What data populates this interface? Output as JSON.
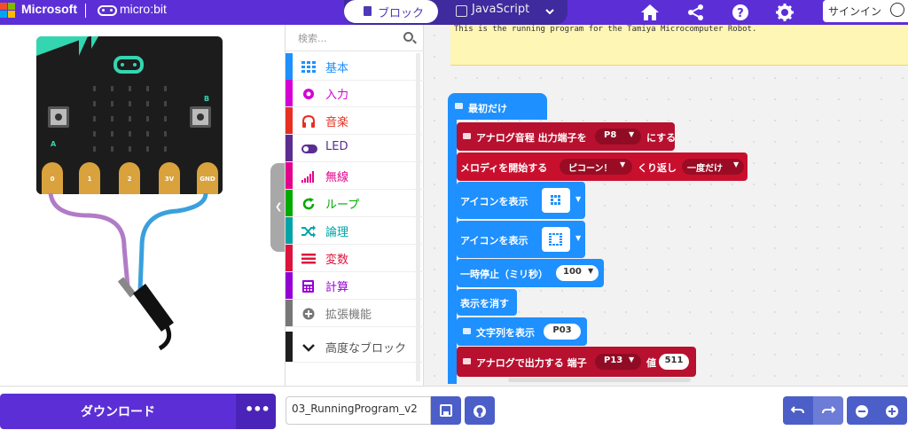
{
  "header": {
    "brand": "Microsoft",
    "product": "micro:bit",
    "tab_blocks": "ブロック",
    "tab_js": "JavaScript",
    "signin": "サインイン"
  },
  "simulator": {
    "pins": [
      "0",
      "1",
      "2",
      "3V",
      "GND"
    ],
    "button_a": "A",
    "button_b": "B"
  },
  "toolbox": {
    "search_placeholder": "検索...",
    "categories": [
      {
        "label": "基本",
        "color": "#1e90ff",
        "icon": "grid-icon"
      },
      {
        "label": "入力",
        "color": "#d400d4",
        "icon": "target-icon"
      },
      {
        "label": "音楽",
        "color": "#e63022",
        "icon": "headphones-icon"
      },
      {
        "label": "LED",
        "color": "#5c2d91",
        "icon": "toggle-icon"
      },
      {
        "label": "無線",
        "color": "#e3008c",
        "icon": "signal-bars-icon"
      },
      {
        "label": "ループ",
        "color": "#00aa00",
        "icon": "refresh-icon"
      },
      {
        "label": "論理",
        "color": "#00a4a6",
        "icon": "shuffle-icon"
      },
      {
        "label": "変数",
        "color": "#dc143c",
        "icon": "list-icon"
      },
      {
        "label": "計算",
        "color": "#9400d3",
        "icon": "calculator-icon"
      },
      {
        "label": "拡張機能",
        "color": "#777777",
        "icon": "plus-circle-icon"
      },
      {
        "label": "高度なブロック",
        "color": "#1f1f1f",
        "icon": "chevron-down-icon"
      }
    ]
  },
  "workspace": {
    "comment": "This is the running program for the Tamiya Microcomputer Robot.",
    "on_start": "最初だけ",
    "analog_pitch": {
      "label": "アナログ音程 出力端子を",
      "pin": "P8",
      "suffix": "にする"
    },
    "melody": {
      "label": "メロディを開始する",
      "melody": "ピコーン！",
      "repeat_label": "くり返し",
      "repeat": "一度だけ"
    },
    "show_icon_1": "アイコンを表示",
    "show_icon_2": "アイコンを表示",
    "pause": {
      "label": "一時停止（ミリ秒）",
      "value": "100"
    },
    "clear": "表示を消す",
    "show_string": {
      "label": "文字列を表示",
      "value": "P03"
    },
    "analog_write": {
      "label": "アナログで出力する 端子",
      "pin": "P13",
      "value_label": "値",
      "value": "511"
    }
  },
  "bottom": {
    "download": "ダウンロード",
    "more": "•••",
    "project_name": "03_RunningProgram_v2"
  }
}
